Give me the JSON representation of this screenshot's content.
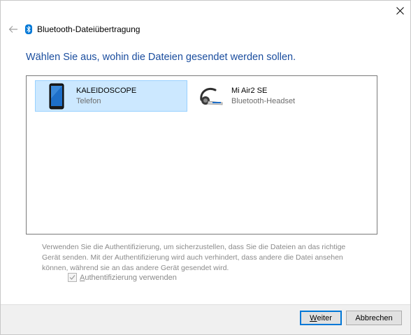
{
  "window": {
    "title": "Bluetooth-Dateiübertragung"
  },
  "instruction": "Wählen Sie aus, wohin die Dateien gesendet werden sollen.",
  "devices": [
    {
      "name": "KALEIDOSCOPE",
      "type": "Telefon",
      "icon": "phone-icon",
      "selected": true
    },
    {
      "name": "Mi Air2 SE",
      "type": "Bluetooth-Headset",
      "icon": "headset-icon",
      "selected": false
    }
  ],
  "auth": {
    "description": "Verwenden Sie die Authentifizierung, um sicherzustellen, dass Sie die Dateien an das richtige Gerät senden. Mit der Authentifizierung wird auch verhindert, dass andere die Datei ansehen können, während sie an das andere Gerät gesendet wird.",
    "checkbox_label": "Authentifizierung verwenden",
    "checkbox_mnemonic": "A",
    "checkbox_rest": "uthentifizierung verwenden",
    "checked": true
  },
  "buttons": {
    "next_mnemonic": "W",
    "next_rest": "eiter",
    "next_label": "Weiter",
    "cancel_label": "Abbrechen"
  },
  "colors": {
    "accent": "#0078d7",
    "instruction": "#1a4d9e",
    "selection_bg": "#cce8ff",
    "selection_border": "#99d1ff",
    "footer_bg": "#f0f0f0",
    "disabled_text": "#8a8a8a"
  }
}
